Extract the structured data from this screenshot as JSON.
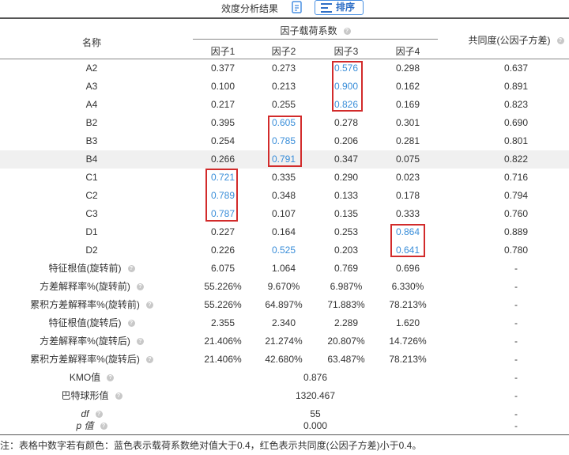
{
  "toolbar": {
    "title": "效度分析结果",
    "doc_icon": "document-icon",
    "sort_icon": "sort-list-icon",
    "sort_label": "排序"
  },
  "table": {
    "header": {
      "name": "名称",
      "group": "因子载荷系数",
      "communality": "共同度(公因子方差)",
      "factors": [
        "因子1",
        "因子2",
        "因子3",
        "因子4"
      ]
    },
    "rows": [
      {
        "name": "A2",
        "f": [
          "0.377",
          "0.273",
          "0.576",
          "0.298"
        ],
        "comm": "0.637"
      },
      {
        "name": "A3",
        "f": [
          "0.100",
          "0.213",
          "0.900",
          "0.162"
        ],
        "comm": "0.891"
      },
      {
        "name": "A4",
        "f": [
          "0.217",
          "0.255",
          "0.826",
          "0.169"
        ],
        "comm": "0.823"
      },
      {
        "name": "B2",
        "f": [
          "0.395",
          "0.605",
          "0.278",
          "0.301"
        ],
        "comm": "0.690"
      },
      {
        "name": "B3",
        "f": [
          "0.254",
          "0.785",
          "0.206",
          "0.281"
        ],
        "comm": "0.801"
      },
      {
        "name": "B4",
        "f": [
          "0.266",
          "0.791",
          "0.347",
          "0.075"
        ],
        "comm": "0.822"
      },
      {
        "name": "C1",
        "f": [
          "0.721",
          "0.335",
          "0.290",
          "0.023"
        ],
        "comm": "0.716"
      },
      {
        "name": "C2",
        "f": [
          "0.789",
          "0.348",
          "0.133",
          "0.178"
        ],
        "comm": "0.794"
      },
      {
        "name": "C3",
        "f": [
          "0.787",
          "0.107",
          "0.135",
          "0.333"
        ],
        "comm": "0.760"
      },
      {
        "name": "D1",
        "f": [
          "0.227",
          "0.164",
          "0.253",
          "0.864"
        ],
        "comm": "0.889"
      },
      {
        "name": "D2",
        "f": [
          "0.226",
          "0.525",
          "0.203",
          "0.641"
        ],
        "comm": "0.780"
      }
    ],
    "stats": [
      {
        "name": "特征根值(旋转前)",
        "f": [
          "6.075",
          "1.064",
          "0.769",
          "0.696"
        ],
        "comm": "-"
      },
      {
        "name": "方差解释率%(旋转前)",
        "f": [
          "55.226%",
          "9.670%",
          "6.987%",
          "6.330%"
        ],
        "comm": "-"
      },
      {
        "name": "累积方差解释率%(旋转前)",
        "f": [
          "55.226%",
          "64.897%",
          "71.883%",
          "78.213%"
        ],
        "comm": "-"
      },
      {
        "name": "特征根值(旋转后)",
        "f": [
          "2.355",
          "2.340",
          "2.289",
          "1.620"
        ],
        "comm": "-"
      },
      {
        "name": "方差解释率%(旋转后)",
        "f": [
          "21.406%",
          "21.274%",
          "20.807%",
          "14.726%"
        ],
        "comm": "-"
      },
      {
        "name": "累积方差解释率%(旋转后)",
        "f": [
          "21.406%",
          "42.680%",
          "63.487%",
          "78.213%"
        ],
        "comm": "-"
      }
    ],
    "tests": [
      {
        "name": "KMO值",
        "value": "0.876",
        "comm": "-"
      },
      {
        "name": "巴特球形值",
        "value": "1320.467",
        "comm": "-"
      },
      {
        "name": "df",
        "value": "55",
        "comm": "-"
      },
      {
        "name": "p 值",
        "value": "0.000",
        "comm": "-"
      }
    ]
  },
  "help_icon": "question-circle-icon",
  "colors": {
    "loading_highlight": "#3a8ed9",
    "box_outline": "#d22b2b",
    "shaded_row": "#f0f0f0"
  },
  "note": "注：表格中数字若有颜色：蓝色表示载荷系数绝对值大于0.4，红色表示共同度(公因子方差)小于0.4。"
}
